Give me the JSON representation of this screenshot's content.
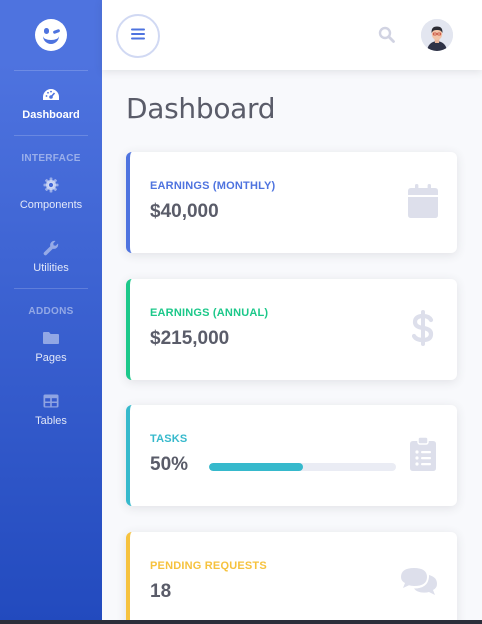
{
  "colors": {
    "primary": "#4e73df",
    "success": "#1cc88a",
    "info": "#36b9cc",
    "warning": "#f6c23e",
    "text_dark": "#5a5c69",
    "icon_muted": "#dddfeb"
  },
  "sidebar": {
    "brand_icon": "laugh-wink-icon",
    "items": [
      {
        "label": "Dashboard",
        "icon": "tachometer-icon",
        "active": true
      }
    ],
    "sections": [
      {
        "heading": "INTERFACE",
        "items": [
          {
            "label": "Components",
            "icon": "cog-icon"
          },
          {
            "label": "Utilities",
            "icon": "wrench-icon"
          }
        ]
      },
      {
        "heading": "ADDONS",
        "items": [
          {
            "label": "Pages",
            "icon": "folder-icon"
          },
          {
            "label": "Tables",
            "icon": "table-icon"
          }
        ]
      }
    ]
  },
  "topbar": {
    "toggle_icon": "bars-icon",
    "search_icon": "search-icon",
    "avatar": "user-avatar"
  },
  "main": {
    "title": "Dashboard",
    "cards": [
      {
        "label": "EARNINGS (MONTHLY)",
        "value": "$40,000",
        "accent": "#4e73df",
        "icon": "calendar-icon"
      },
      {
        "label": "EARNINGS (ANNUAL)",
        "value": "$215,000",
        "accent": "#1cc88a",
        "icon": "dollar-icon"
      },
      {
        "label": "TASKS",
        "value": "50%",
        "accent": "#36b9cc",
        "icon": "clipboard-list-icon",
        "progress": 0.5
      },
      {
        "label": "PENDING REQUESTS",
        "value": "18",
        "accent": "#f6c23e",
        "icon": "comments-icon"
      }
    ]
  }
}
